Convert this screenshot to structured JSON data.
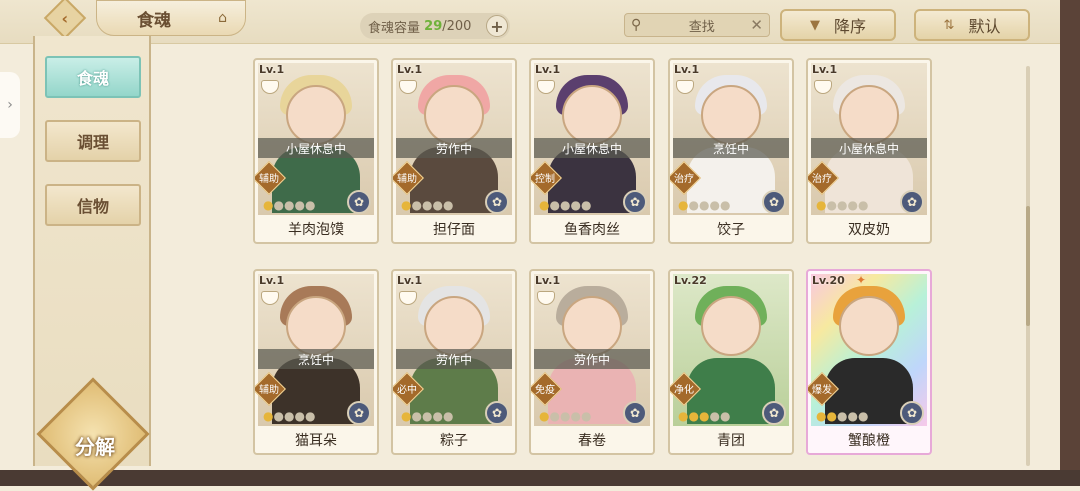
{
  "header": {
    "title": "食魂",
    "capacity_label": "食魂容量",
    "capacity_current": "29",
    "capacity_max": "/200",
    "search_placeholder": "查找",
    "sort_order": "降序",
    "sort_mode": "默认"
  },
  "sidebar": {
    "tabs": [
      "食魂",
      "调理",
      "信物"
    ],
    "active": 0,
    "decompose_label": "分解"
  },
  "cards": [
    {
      "level": "Lv.1",
      "status": "小屋休息中",
      "role": "辅助",
      "stars": 1,
      "name": "羊肉泡馍",
      "hair": "#e8d59a",
      "outfit": "#3f6b4a"
    },
    {
      "level": "Lv.1",
      "status": "劳作中",
      "role": "辅助",
      "stars": 1,
      "name": "担仔面",
      "hair": "#f0a7a5",
      "outfit": "#5a4a3e"
    },
    {
      "level": "Lv.1",
      "status": "小屋休息中",
      "role": "控制",
      "stars": 1,
      "name": "鱼香肉丝",
      "hair": "#5b3f6e",
      "outfit": "#3b3340"
    },
    {
      "level": "Lv.1",
      "status": "烹饪中",
      "role": "治疗",
      "stars": 1,
      "name": "饺子",
      "hair": "#e8e8ec",
      "outfit": "#f4f1ec"
    },
    {
      "level": "Lv.1",
      "status": "小屋休息中",
      "role": "治疗",
      "stars": 1,
      "name": "双皮奶",
      "hair": "#ece7e2",
      "outfit": "#efe4d8"
    },
    {
      "level": "Lv.1",
      "status": "烹饪中",
      "role": "辅助",
      "stars": 1,
      "name": "猫耳朵",
      "hair": "#a87a58",
      "outfit": "#3d3229"
    },
    {
      "level": "Lv.1",
      "status": "劳作中",
      "role": "必中",
      "stars": 1,
      "name": "粽子",
      "hair": "#e4e4e4",
      "outfit": "#5e7c4a"
    },
    {
      "level": "Lv.1",
      "status": "劳作中",
      "role": "免疫",
      "stars": 1,
      "name": "春卷",
      "hair": "#b9ad9c",
      "outfit": "#eab3b3"
    },
    {
      "level": "Lv.22",
      "status": "",
      "role": "净化",
      "stars": 3,
      "name": "青团",
      "hair": "#6fb05a",
      "outfit": "#3f7e4a"
    },
    {
      "level": "Lv.20",
      "status": "",
      "role": "爆发",
      "stars": 2,
      "name": "蟹酿橙",
      "hair": "#e8a23c",
      "outfit": "#2a2a2a"
    }
  ]
}
